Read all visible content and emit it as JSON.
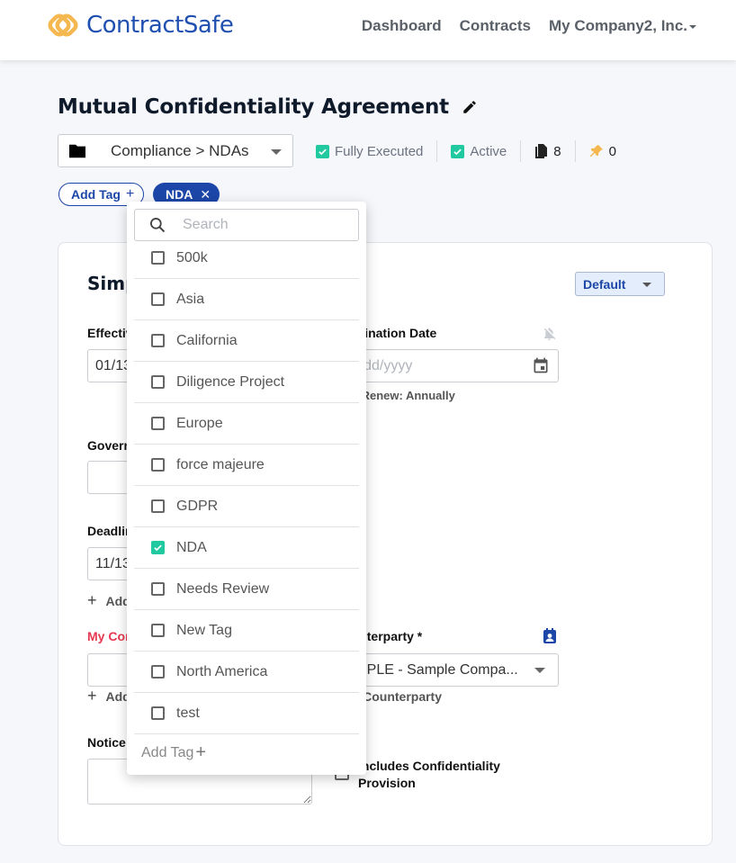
{
  "header": {
    "brand": "ContractSafe",
    "nav": [
      {
        "label": "Dashboard"
      },
      {
        "label": "Contracts"
      },
      {
        "label": "My Company2, Inc."
      }
    ]
  },
  "contract": {
    "title": "Mutual Confidentiality Agreement",
    "folder": "Compliance > NDAs",
    "status": {
      "fully_executed": {
        "label": "Fully Executed",
        "checked": true
      },
      "active": {
        "label": "Active",
        "checked": true
      },
      "documents_count": "8",
      "pins_count": "0"
    },
    "tags": {
      "add_label": "Add Tag",
      "applied": [
        "NDA"
      ]
    }
  },
  "card": {
    "title": "Simple",
    "view_select": "Default",
    "fields": {
      "effective_date": {
        "label": "Effective Date",
        "value": "01/13"
      },
      "termination_date": {
        "label": "Termination Date",
        "placeholder": "mm/dd/yyyy",
        "note": "AutoRenew: Annually"
      },
      "governing": {
        "label": "Governing Law",
        "value": ""
      },
      "deadline": {
        "label": "Deadline",
        "value": "11/13",
        "add_label": "Add"
      },
      "my_company": {
        "label": "My Company",
        "value": "",
        "add_label": "Add"
      },
      "counterparty": {
        "label": "Counterparty *",
        "value": "SAMPLE - Sample Compa...",
        "add_label": "Add Counterparty"
      },
      "notice": {
        "label": "Notice",
        "value": ""
      },
      "confidentiality": {
        "label": "Includes Confidentiality Provision",
        "checked": false
      }
    }
  },
  "tag_dropdown": {
    "search_placeholder": "Search",
    "options": [
      {
        "label": "500k",
        "checked": false
      },
      {
        "label": "Asia",
        "checked": false
      },
      {
        "label": "California",
        "checked": false
      },
      {
        "label": "Diligence Project",
        "checked": false
      },
      {
        "label": "Europe",
        "checked": false
      },
      {
        "label": "force majeure",
        "checked": false
      },
      {
        "label": "GDPR",
        "checked": false
      },
      {
        "label": "NDA",
        "checked": true
      },
      {
        "label": "Needs Review",
        "checked": false
      },
      {
        "label": "New Tag",
        "checked": false
      },
      {
        "label": "North America",
        "checked": false
      },
      {
        "label": "test",
        "checked": false
      }
    ],
    "footer_label": "Add Tag"
  },
  "colors": {
    "brand_blue": "#1f4fb0",
    "brand_orange": "#f5b851",
    "check_green": "#20c9a0",
    "required_red": "#e63950"
  }
}
